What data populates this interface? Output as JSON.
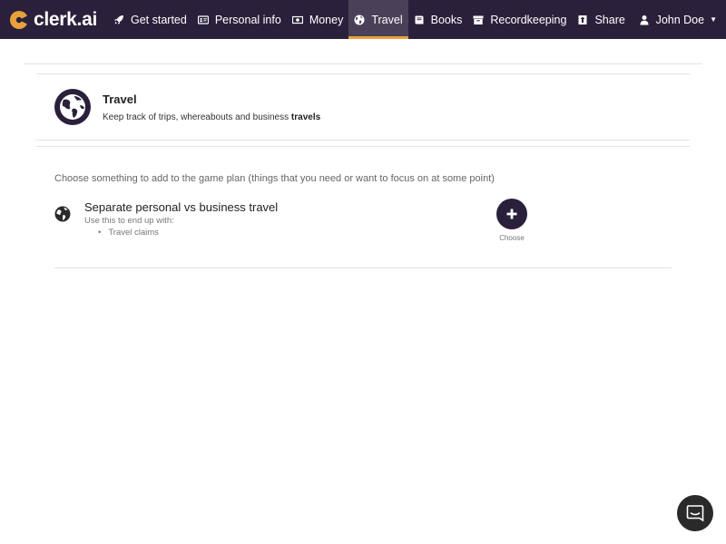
{
  "brand": {
    "name": "clerk.ai",
    "accent": "#e8a13a"
  },
  "nav": {
    "items": [
      {
        "label": "Get started",
        "icon": "rocket-icon"
      },
      {
        "label": "Personal info",
        "icon": "id-card-icon"
      },
      {
        "label": "Money",
        "icon": "money-icon"
      },
      {
        "label": "Travel",
        "icon": "globe-icon",
        "active": true
      },
      {
        "label": "Books",
        "icon": "book-icon"
      },
      {
        "label": "Recordkeeping",
        "icon": "archive-icon"
      },
      {
        "label": "Share",
        "icon": "share-icon"
      }
    ],
    "user": {
      "name": "John Doe",
      "icon": "user-icon"
    }
  },
  "section": {
    "title": "Travel",
    "subtitle_prefix": "Keep track of trips, whereabouts and business ",
    "subtitle_bold": "travels"
  },
  "prompt": "Choose something to add to the game plan (things that you need or want to focus on at some point)",
  "options": [
    {
      "title": "Separate personal vs business travel",
      "subtitle": "Use this to end up with:",
      "outcomes": [
        "Travel claims"
      ],
      "button_label": "Choose"
    }
  ],
  "colors": {
    "nav_bg": "#2a203b",
    "nav_active_bg": "#4a4058"
  }
}
